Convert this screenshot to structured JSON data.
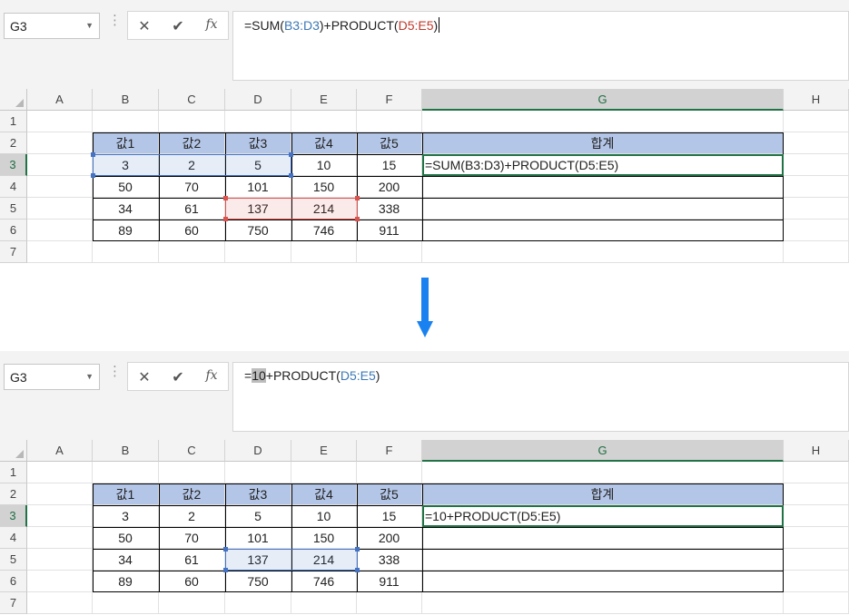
{
  "top": {
    "name_box": "G3",
    "formula": {
      "p1": "=SUM(",
      "p2": "B3:D3",
      "p3": ")+PRODUCT(",
      "p4": "D5:E5",
      "p5": ")"
    },
    "cell_text": "=SUM(B3:D3)+PRODUCT(D5:E5)"
  },
  "bottom": {
    "name_box": "G3",
    "formula": {
      "p1": "=",
      "p2": "10",
      "p3": "+PRODUCT(",
      "p4": "D5:E5",
      "p5": ")"
    },
    "cell_text": "=10+PRODUCT(D5:E5)"
  },
  "buttons": {
    "cancel": "✕",
    "enter": "✔",
    "fx": "fx"
  },
  "columns": [
    "A",
    "B",
    "C",
    "D",
    "E",
    "F",
    "G",
    "H"
  ],
  "rows": [
    "1",
    "2",
    "3",
    "4",
    "5",
    "6",
    "7"
  ],
  "table": {
    "headers": [
      "값1",
      "값2",
      "값3",
      "값4",
      "값5",
      "합계"
    ],
    "rows": [
      [
        "3",
        "2",
        "5",
        "10",
        "15"
      ],
      [
        "50",
        "70",
        "101",
        "150",
        "200"
      ],
      [
        "34",
        "61",
        "137",
        "214",
        "338"
      ],
      [
        "89",
        "60",
        "750",
        "746",
        "911"
      ]
    ]
  },
  "colors": {
    "header_fill": "#b4c6e7",
    "selection_green": "#217346",
    "ref_blue": "#4472c4",
    "ref_red": "#d9534f",
    "arrow": "#1a82f0"
  }
}
